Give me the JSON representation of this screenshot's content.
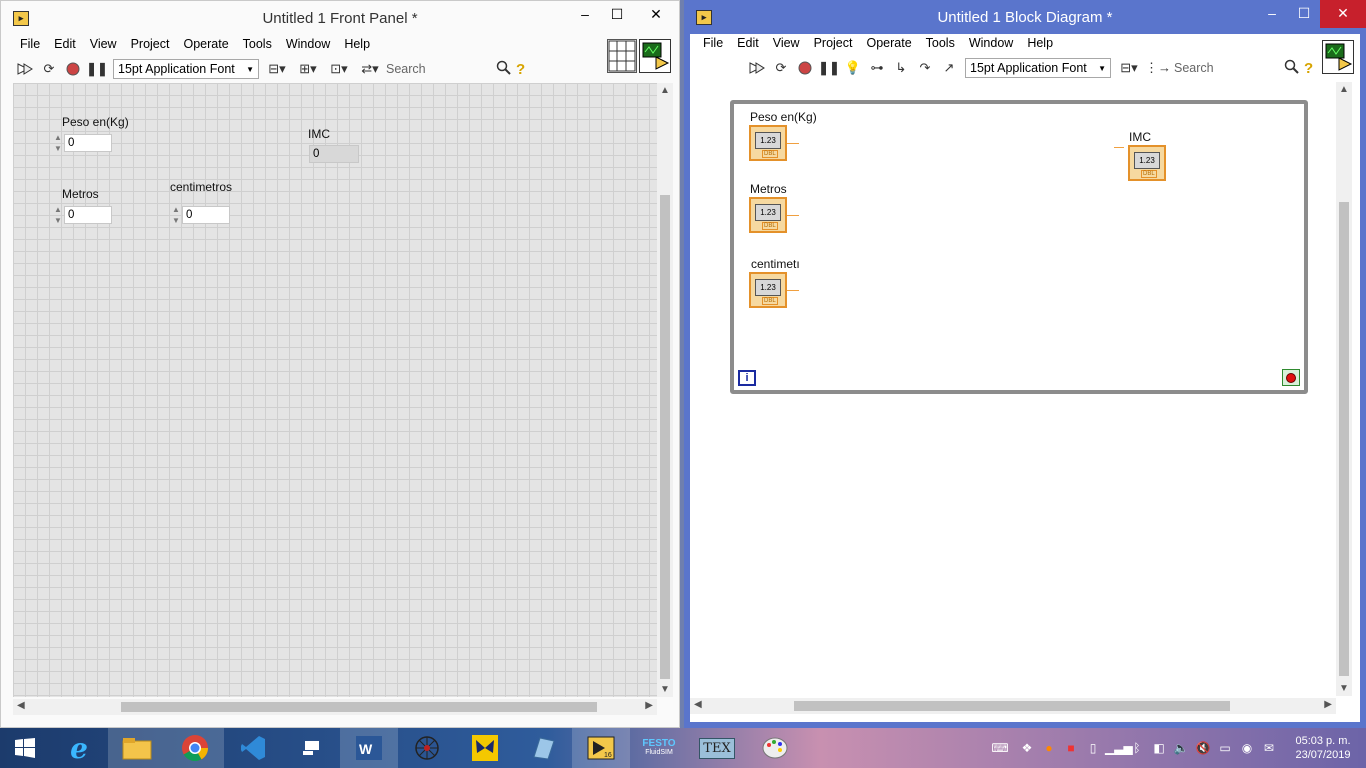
{
  "front_panel": {
    "title": "Untitled 1 Front Panel *",
    "menu": [
      "File",
      "Edit",
      "View",
      "Project",
      "Operate",
      "Tools",
      "Window",
      "Help"
    ],
    "font_ring": "15pt Application Font",
    "search_placeholder": "Search",
    "controls": {
      "peso": {
        "label": "Peso en(Kg)",
        "value": "0"
      },
      "metros": {
        "label": "Metros",
        "value": "0"
      },
      "centimetros": {
        "label": "centimetros",
        "value": "0"
      },
      "imc": {
        "label": "IMC",
        "value": "0"
      }
    }
  },
  "block_diagram": {
    "title": "Untitled 1 Block Diagram *",
    "menu": [
      "File",
      "Edit",
      "View",
      "Project",
      "Operate",
      "Tools",
      "Window",
      "Help"
    ],
    "font_ring": "15pt Application Font",
    "search_placeholder": "Search",
    "terminals": {
      "peso": {
        "label": "Peso en(Kg)",
        "glyph": "1.23",
        "type": "DBL"
      },
      "metros": {
        "label": "Metros",
        "glyph": "1.23",
        "type": "DBL"
      },
      "centimetros": {
        "label": "centimetı",
        "glyph": "1.23",
        "type": "DBL"
      },
      "imc": {
        "label": "IMC",
        "glyph": "1.23",
        "type": "DBL"
      }
    },
    "iteration_terminal": "i"
  },
  "taskbar": {
    "apps": [
      "start-icon",
      "internet-explorer-icon",
      "file-explorer-icon",
      "chrome-icon",
      "visual-studio-code-icon",
      "task-view-icon",
      "word-icon",
      "spider-icon",
      "butterfly-app-icon",
      "notes-app-icon",
      "labview-icon",
      "festo-fluidsim-icon",
      "tex-icon",
      "paint-icon"
    ],
    "festo_label": "FESTO",
    "festo_sub": "FluidSIM",
    "tex_label": "TEX",
    "clock_time": "05:03 p. m.",
    "clock_date": "23/07/2019"
  }
}
